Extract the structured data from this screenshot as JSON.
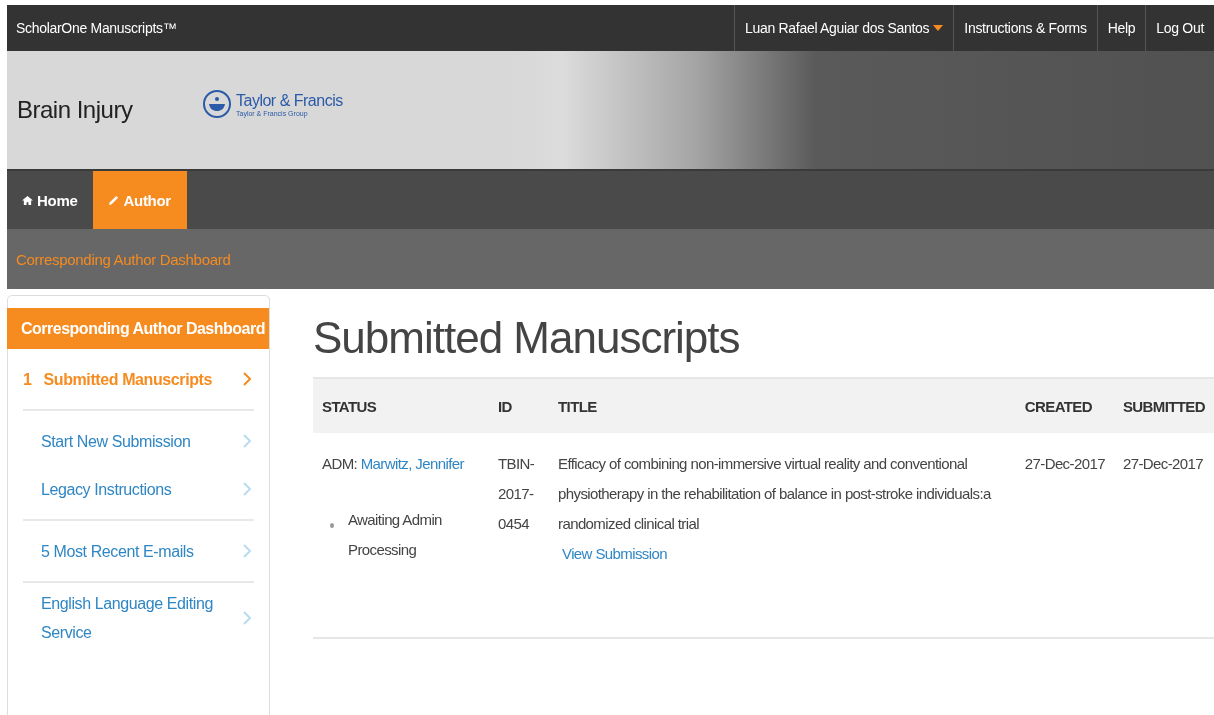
{
  "top_bar": {
    "brand": "ScholarOne Manuscripts™",
    "user_menu": "Luan Rafael Aguiar dos Santos",
    "links": [
      "Instructions & Forms",
      "Help",
      "Log Out"
    ]
  },
  "header": {
    "journal": "Brain Injury",
    "publisher": "Taylor & Francis",
    "publisher_group": "Taylor & Francis Group"
  },
  "nav_tabs": [
    {
      "label": "Home",
      "kind": "home",
      "selected": false
    },
    {
      "label": "Author",
      "kind": "edit",
      "selected": true
    }
  ],
  "breadcrumb": "Corresponding Author Dashboard",
  "sidebar": {
    "title": "Corresponding Author Dashboard",
    "groups": [
      {
        "items": [
          {
            "count": "1",
            "label": "Submitted Manuscripts",
            "selected": true
          }
        ]
      },
      {
        "items": [
          {
            "label": "Start New Submission",
            "selected": false
          },
          {
            "label": "Legacy Instructions",
            "selected": false
          }
        ]
      },
      {
        "items": [
          {
            "label": "5 Most Recent E-mails",
            "selected": false
          }
        ]
      },
      {
        "items": [
          {
            "label": "English Language Editing Service",
            "selected": false
          }
        ]
      }
    ]
  },
  "main": {
    "title": "Submitted Manuscripts",
    "table": {
      "columns": [
        "STATUS",
        "ID",
        "TITLE",
        "CREATED",
        "SUBMITTED"
      ],
      "rows": [
        {
          "status_prefix": "ADM:",
          "admin": "Marwitz, Jennifer",
          "status": "Awaiting Admin Processing",
          "id": "TBIN-2017-0454",
          "title": "Efficacy of combining non-immersive virtual reality and conventional physiotherapy in the rehabilitation of balance in post-stroke individuals:a randomized clinical trial",
          "link": "View Submission",
          "created": "27-Dec-2017",
          "submitted": "27-Dec-2017"
        }
      ]
    }
  }
}
